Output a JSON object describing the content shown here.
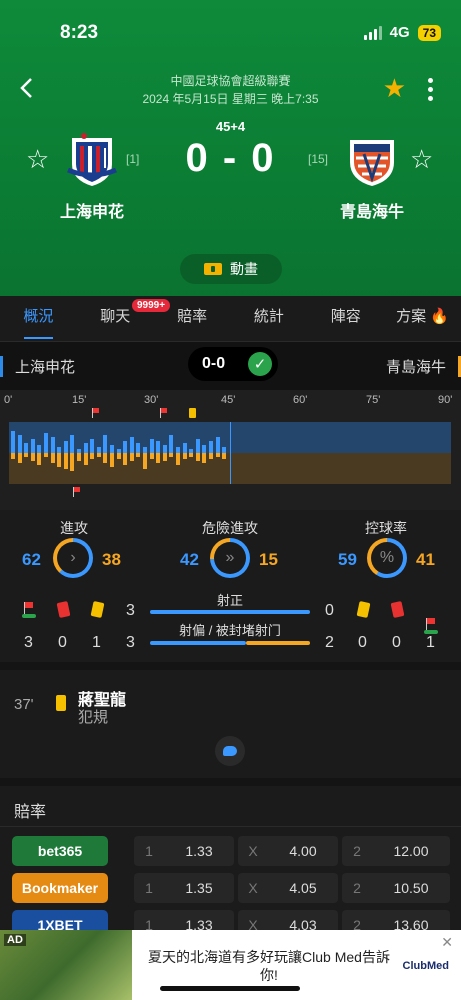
{
  "status": {
    "time": "8:23",
    "network": "4G",
    "battery": "73"
  },
  "match": {
    "league": "中國足球協會超級聯賽",
    "datetime": "2024 年5月15日 星期三 晚上7:35",
    "period": "45+4",
    "score": "0 - 0",
    "home": {
      "name": "上海申花",
      "rank": "[1]"
    },
    "away": {
      "name": "青島海牛",
      "rank": "[15]"
    },
    "animation_label": "動畫"
  },
  "tabs": [
    "概況",
    "聊天",
    "賠率",
    "統計",
    "陣容",
    "方案"
  ],
  "tab_badge": "9999+",
  "strip": {
    "home": "上海申花",
    "away": "青島海牛",
    "score": "0-0"
  },
  "timeline": {
    "ticks": [
      "0'",
      "15'",
      "30'",
      "45'",
      "60'",
      "75'",
      "90'"
    ]
  },
  "stats": {
    "attack": {
      "label": "進攻",
      "home": "62",
      "away": "38"
    },
    "dangerous": {
      "label": "危險進攻",
      "home": "42",
      "away": "15"
    },
    "possession": {
      "label": "控球率",
      "home": "59",
      "away": "41",
      "symbol": "%"
    },
    "home_events": {
      "corners": "3",
      "red": "0",
      "yellow": "1"
    },
    "away_events": {
      "corners": "1",
      "red": "0",
      "yellow": "0"
    },
    "on_target": {
      "label": "射正",
      "home": "3",
      "away": "0"
    },
    "off_target": {
      "label": "射偏 / 被封堵射门",
      "home": "3",
      "away": "2"
    }
  },
  "event": {
    "minute": "37'",
    "player": "蔣聖龍",
    "desc": "犯規"
  },
  "odds": {
    "title": "賠率",
    "rows": [
      {
        "book": "bet365",
        "k1": "1",
        "v1": "1.33",
        "kx": "X",
        "vx": "4.00",
        "k2": "2",
        "v2": "12.00",
        "color": "#1f7a3a"
      },
      {
        "book": "Bookmaker",
        "k1": "1",
        "v1": "1.35",
        "kx": "X",
        "vx": "4.05",
        "k2": "2",
        "v2": "10.50",
        "color": "#e58a12"
      },
      {
        "book": "1XBET",
        "k1": "1",
        "v1": "1.33",
        "kx": "X",
        "vx": "4.03",
        "k2": "2",
        "v2": "13.60",
        "color": "#1a4fa0"
      }
    ]
  },
  "ad": {
    "tag": "AD",
    "text": "夏天的北海道有多好玩讓Club Med告訴你!",
    "brand": "ClubMed"
  },
  "colors": {
    "accent": "#3b98ff",
    "away": "#f5a623",
    "header": "#0b7d34"
  }
}
